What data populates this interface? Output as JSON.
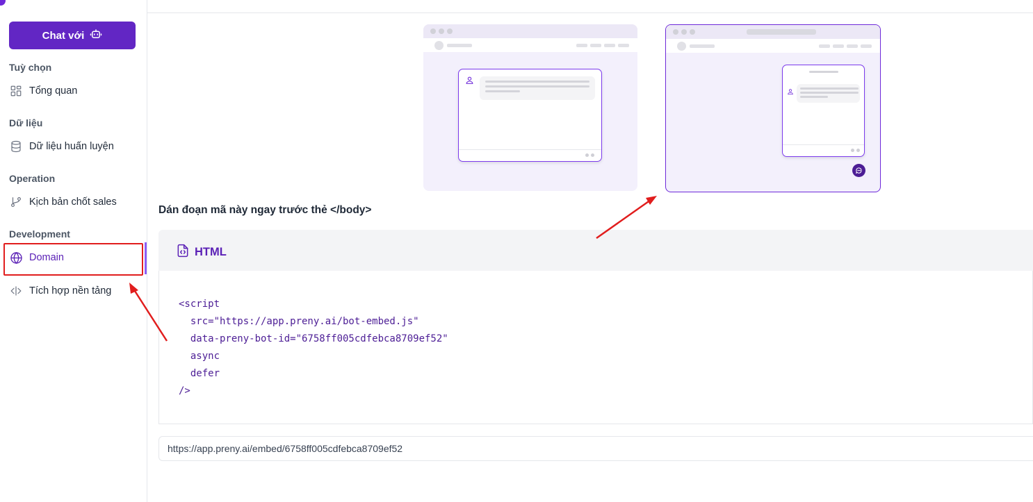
{
  "sidebar": {
    "chat_button_label": "Chat với",
    "sections": {
      "options": "Tuỳ chọn",
      "data": "Dữ liệu",
      "operation": "Operation",
      "development": "Development"
    },
    "items": {
      "overview": "Tổng quan",
      "training_data": "Dữ liệu huấn luyện",
      "sales_script": "Kịch bản chốt sales",
      "domain": "Domain",
      "platform_integration": "Tích hợp nền tảng"
    },
    "active_item": "Domain"
  },
  "main": {
    "instruction": "Dán đoạn mã này ngay trước thẻ </body>",
    "code_tab_label": "HTML",
    "code_snippet": "<script\n  src=\"https://app.preny.ai/bot-embed.js\"\n  data-preny-bot-id=\"6758ff005cdfebca8709ef52\"\n  async\n  defer\n/>",
    "embed_url": "https://app.preny.ai/embed/6758ff005cdfebca8709ef52",
    "preview_options": [
      "centered-chat-window",
      "floating-chat-bubble"
    ],
    "selected_preview": "floating-chat-bubble"
  },
  "colors": {
    "brand": "#6226c4",
    "active": "#5b21b6",
    "annotation": "#e11d1d"
  }
}
